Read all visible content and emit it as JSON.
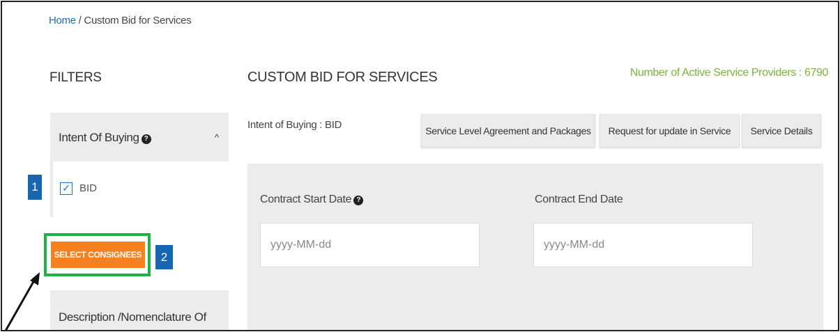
{
  "breadcrumb": {
    "home": "Home",
    "separator": " / ",
    "current": "Custom Bid for Services"
  },
  "filters": {
    "title": "FILTERS",
    "intent_panel": {
      "label": "Intent Of Buying",
      "help_icon": "?",
      "caret": "^",
      "expanded": true
    },
    "intent_option": {
      "label": "BID",
      "checked": true,
      "check_glyph": "✓"
    },
    "select_consignees_label": "SELECT CONSIGNEES",
    "description_panel_label": "Description /Nomenclature Of"
  },
  "annotations": {
    "badge_1": "1",
    "badge_2": "2",
    "highlight_color": "#1db244",
    "arrow": "black-arrow"
  },
  "main": {
    "title": "CUSTOM BID FOR SERVICES",
    "active_providers": "Number of Active Service Providers : 6790",
    "intent_text": "Intent of Buying : BID",
    "tabs": [
      {
        "label": "Service Level Agreement and Packages"
      },
      {
        "label": "Request for update in Service"
      },
      {
        "label": "Service Details"
      }
    ],
    "form": {
      "start_label": "Contract Start Date",
      "start_help_icon": "?",
      "end_label": "Contract End Date",
      "start_placeholder": "yyyy-MM-dd",
      "end_placeholder": "yyyy-MM-dd"
    }
  },
  "colors": {
    "accent_orange": "#f4801f",
    "badge_blue": "#1766b1",
    "link_blue": "#1a6fb5",
    "provider_green": "#7cb342",
    "panel_gray": "#ececec"
  }
}
